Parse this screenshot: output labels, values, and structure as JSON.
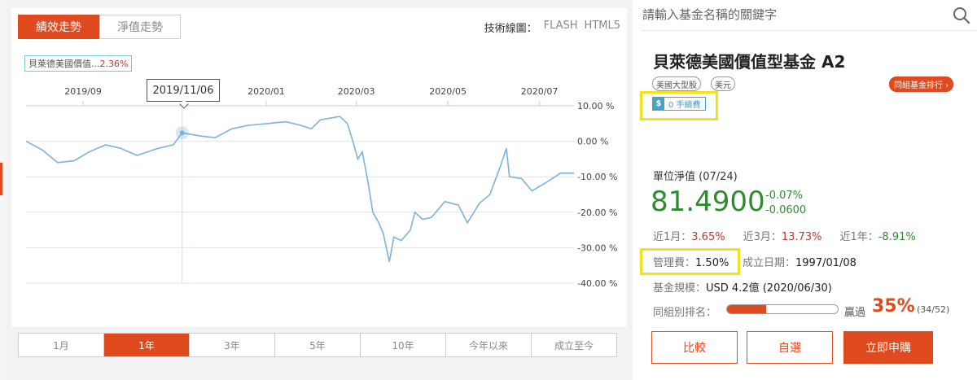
{
  "chart_tabs": [
    "績效走勢",
    "淨值走勢"
  ],
  "tech_chart": {
    "label": "技術線圖：",
    "options": [
      "FLASH",
      "HTML5"
    ]
  },
  "legend": {
    "name": "貝萊德美國價值...",
    "pct": "2.36%"
  },
  "tooltip_date": "2019/11/06",
  "ranges": [
    "1月",
    "1年",
    "3年",
    "5年",
    "10年",
    "今年以來",
    "成立至今"
  ],
  "active_range": "1年",
  "chart_data": {
    "type": "line",
    "series": [
      {
        "values": [
          [
            "2019-07-25",
            0.0
          ],
          [
            "2019-08-05",
            -2.5
          ],
          [
            "2019-08-15",
            -6.0
          ],
          [
            "2019-08-26",
            -5.5
          ],
          [
            "2019-09-05",
            -3.0
          ],
          [
            "2019-09-16",
            -1.0
          ],
          [
            "2019-09-26",
            -2.0
          ],
          [
            "2019-10-07",
            -4.0
          ],
          [
            "2019-10-21",
            -2.0
          ],
          [
            "2019-10-31",
            -1.0
          ],
          [
            "2019-11-06",
            2.36
          ],
          [
            "2019-11-18",
            1.5
          ],
          [
            "2019-11-28",
            1.0
          ],
          [
            "2019-12-09",
            3.5
          ],
          [
            "2019-12-20",
            4.5
          ],
          [
            "2020-01-02",
            5.0
          ],
          [
            "2020-01-14",
            5.5
          ],
          [
            "2020-01-24",
            4.5
          ],
          [
            "2020-01-31",
            3.5
          ],
          [
            "2020-02-06",
            6.0
          ],
          [
            "2020-02-12",
            6.5
          ],
          [
            "2020-02-19",
            7.0
          ],
          [
            "2020-02-24",
            5.0
          ],
          [
            "2020-02-27",
            1.0
          ],
          [
            "2020-03-02",
            -5.0
          ],
          [
            "2020-03-05",
            -3.0
          ],
          [
            "2020-03-09",
            -12.0
          ],
          [
            "2020-03-12",
            -20.0
          ],
          [
            "2020-03-16",
            -23.0
          ],
          [
            "2020-03-19",
            -26.0
          ],
          [
            "2020-03-23",
            -34.0
          ],
          [
            "2020-03-26",
            -27.0
          ],
          [
            "2020-03-31",
            -28.0
          ],
          [
            "2020-04-06",
            -25.0
          ],
          [
            "2020-04-09",
            -20.0
          ],
          [
            "2020-04-14",
            -22.0
          ],
          [
            "2020-04-20",
            -21.5
          ],
          [
            "2020-04-29",
            -17.0
          ],
          [
            "2020-05-08",
            -18.0
          ],
          [
            "2020-05-14",
            -23.0
          ],
          [
            "2020-05-22",
            -17.5
          ],
          [
            "2020-05-29",
            -15.0
          ],
          [
            "2020-06-05",
            -7.0
          ],
          [
            "2020-06-09",
            -2.0
          ],
          [
            "2020-06-11",
            -10.0
          ],
          [
            "2020-06-19",
            -10.5
          ],
          [
            "2020-06-26",
            -14.0
          ],
          [
            "2020-07-06",
            -11.5
          ],
          [
            "2020-07-15",
            -9.0
          ],
          [
            "2020-07-24",
            -9.0
          ]
        ]
      }
    ],
    "x_ticks": [
      "2019/09",
      "2019/11/06",
      "2020/01",
      "2020/03",
      "2020/05",
      "2020/07"
    ],
    "y_ticks": [
      "10.00 %",
      "0.00 %",
      "-10.00 %",
      "-20.00 %",
      "-30.00 %",
      "-40.00 %"
    ],
    "ylim": [
      -40,
      10
    ],
    "xlim": [
      "2019-07-25",
      "2020-07-24"
    ],
    "grid": true,
    "line_color": "#7ab3dc"
  },
  "search": {
    "placeholder": "請輸入基金名稱的關鍵字"
  },
  "fund": {
    "name": "貝萊德美國價值型基金 A2",
    "tags": [
      "美國大型股",
      "美元"
    ],
    "rank_link": "同組基金排行 ›",
    "fee_badge": "0 手續費",
    "nav_label": "單位淨值 (07/24)",
    "nav_value": "81.4900",
    "nav_change_pct": "-0.07%",
    "nav_change_abs": "-0.0600",
    "perf": [
      {
        "label": "近1月：",
        "value": "3.65%"
      },
      {
        "label": "近3月：",
        "value": "13.73%"
      },
      {
        "label": "近1年：",
        "value": "-8.91%"
      }
    ],
    "mgmt_fee_label": "管理費：",
    "mgmt_fee": "1.50%",
    "inception_label": "成立日期：",
    "inception": "1997/01/08",
    "size_label": "基金規模：",
    "size": "USD 4.2億 (2020/06/30)",
    "rank_label": "同組別排名：",
    "beat_label": "贏過",
    "beat_pct": "35%",
    "beat_fraction": 0.35,
    "beat_count": "(34/52)"
  },
  "buttons": {
    "compare": "比較",
    "watch": "自選",
    "buy": "立即申購"
  },
  "colors": {
    "accent": "#e04a1f",
    "up": "#c0392b",
    "down": "#2e8b2e",
    "highlight": "#f2e21a"
  }
}
